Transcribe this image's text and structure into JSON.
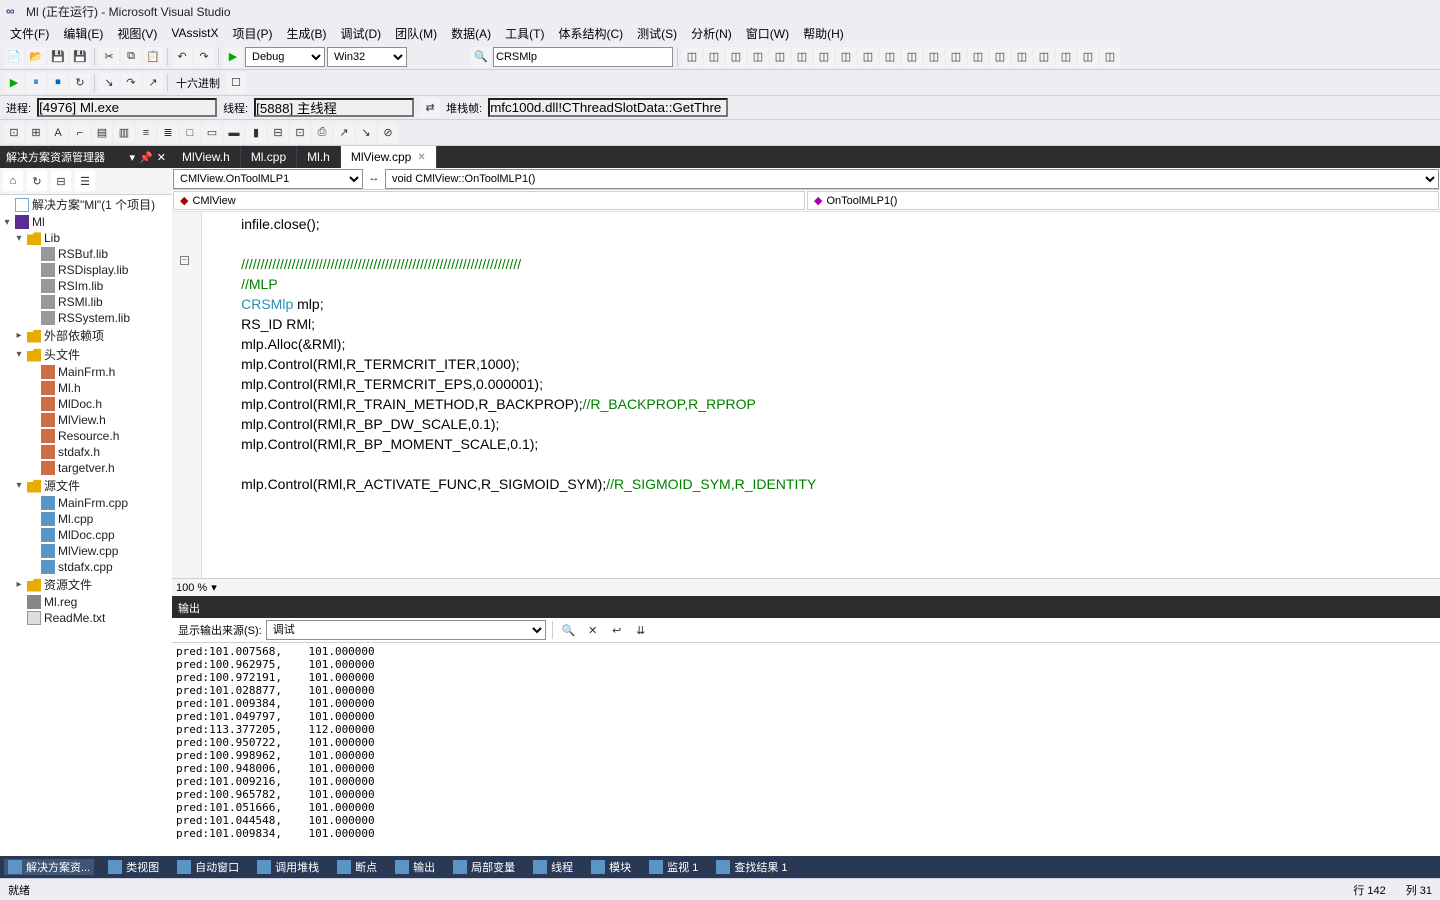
{
  "title": "Ml (正在运行) - Microsoft Visual Studio",
  "menus": [
    "文件(F)",
    "编辑(E)",
    "视图(V)",
    "VAssistX",
    "项目(P)",
    "生成(B)",
    "调试(D)",
    "团队(M)",
    "数据(A)",
    "工具(T)",
    "体系结构(C)",
    "测试(S)",
    "分析(N)",
    "窗口(W)",
    "帮助(H)"
  ],
  "toolbar1": {
    "config": "Debug",
    "platform": "Win32",
    "search": "CRSMlp"
  },
  "debugbar": {
    "proc_label": "进程:",
    "proc": "[4976] Ml.exe",
    "thread_label": "线程:",
    "thread": "[5888] 主线程",
    "stack_label": "堆栈帧:",
    "stack": "mfc100d.dll!CThreadSlotData::GetThre"
  },
  "tb2": {
    "hex": "十六进制"
  },
  "sidebar": {
    "title": "解决方案资源管理器",
    "pin": "▼ ✕",
    "root": "解决方案\"Ml\"(1 个项目)",
    "project": "Ml",
    "folders": {
      "lib": "Lib",
      "libs": [
        "RSBuf.lib",
        "RSDisplay.lib",
        "RSIm.lib",
        "RSMl.lib",
        "RSSystem.lib"
      ],
      "ext": "外部依赖项",
      "headers": "头文件",
      "headers_files": [
        "MainFrm.h",
        "Ml.h",
        "MlDoc.h",
        "MlView.h",
        "Resource.h",
        "stdafx.h",
        "targetver.h"
      ],
      "src": "源文件",
      "src_files": [
        "MainFrm.cpp",
        "Ml.cpp",
        "MlDoc.cpp",
        "MlView.cpp",
        "stdafx.cpp"
      ],
      "res": "资源文件",
      "reg": "Ml.reg",
      "readme": "ReadMe.txt"
    }
  },
  "tabs": [
    "MlView.h",
    "Ml.cpp",
    "Ml.h",
    "MlView.cpp"
  ],
  "active_tab": 3,
  "nav1_left": "CMlView.OnToolMLP1",
  "nav1_right": "void CMlView::OnToolMLP1()",
  "nav2_left": "CMlView",
  "nav2_right": "OnToolMLP1()",
  "code_lines": [
    {
      "t": "        infile.close();"
    },
    {
      "t": ""
    },
    {
      "t": "        ////////////////////////////////////////////////////////////////////////",
      "c": "comment"
    },
    {
      "t": "        //MLP",
      "c": "comment"
    },
    {
      "t": "        CRSMlp mlp;",
      "type": "CRSMlp"
    },
    {
      "t": "        RS_ID RMl;"
    },
    {
      "t": "        mlp.Alloc(&RMl);"
    },
    {
      "t": "        mlp.Control(RMl,R_TERMCRIT_ITER,1000);"
    },
    {
      "t": "        mlp.Control(RMl,R_TERMCRIT_EPS,0.000001);"
    },
    {
      "t": "        mlp.Control(RMl,R_TRAIN_METHOD,R_BACKPROP);//R_BACKPROP,R_RPROP"
    },
    {
      "t": "        mlp.Control(RMl,R_BP_DW_SCALE,0.1);"
    },
    {
      "t": "        mlp.Control(RMl,R_BP_MOMENT_SCALE,0.1);"
    },
    {
      "t": ""
    },
    {
      "t": "        mlp.Control(RMl,R_ACTIVATE_FUNC,R_SIGMOID_SYM);//R_SIGMOID_SYM,R_IDENTITY"
    }
  ],
  "zoom": "100 %",
  "output": {
    "title": "输出",
    "src_label": "显示输出来源(S):",
    "src": "调试",
    "lines": [
      "pred:101.007568,    101.000000",
      "pred:100.962975,    101.000000",
      "pred:100.972191,    101.000000",
      "pred:101.028877,    101.000000",
      "pred:101.009384,    101.000000",
      "pred:101.049797,    101.000000",
      "pred:113.377205,    112.000000",
      "pred:100.950722,    101.000000",
      "pred:100.998962,    101.000000",
      "pred:100.948006,    101.000000",
      "pred:101.009216,    101.000000",
      "pred:100.965782,    101.000000",
      "pred:101.051666,    101.000000",
      "pred:101.044548,    101.000000",
      "pred:101.009834,    101.000000"
    ]
  },
  "bottombar": [
    "解决方案资...",
    "类视图",
    "自动窗口",
    "调用堆栈",
    "断点",
    "输出",
    "局部变量",
    "线程",
    "模块",
    "监视 1",
    "查找结果 1"
  ],
  "bottom_active": [
    0
  ],
  "status": {
    "left": "就绪",
    "line": "行 142",
    "col": "列 31"
  }
}
